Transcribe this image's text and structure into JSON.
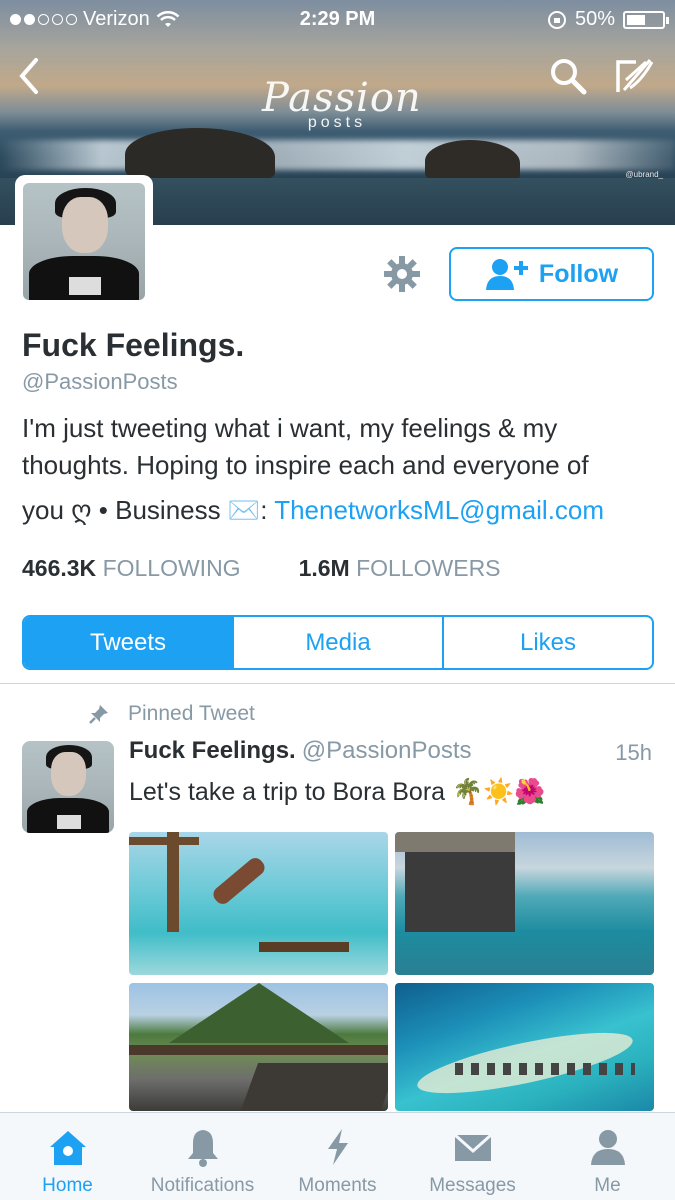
{
  "status_bar": {
    "carrier": "Verizon",
    "time": "2:29 PM",
    "battery": "50%",
    "signal_bars": 2
  },
  "banner": {
    "logo_line1": "Passion",
    "logo_line2": "posts",
    "credit": "@ubrand_"
  },
  "profile": {
    "name": "Fuck Feelings.",
    "handle": "@PassionPosts",
    "follow_label": "Follow",
    "bio_line1": "I'm just tweeting what i want, my feelings & my",
    "bio_line2": "thoughts. Hoping to inspire each and everyone of",
    "bio_line3_prefix": "you ღ • Business ✉️: ",
    "bio_email": "ThenetworksML@gmail.com",
    "following_count": "466.3K",
    "following_label": "FOLLOWING",
    "followers_count": "1.6M",
    "followers_label": "FOLLOWERS"
  },
  "tabs": [
    "Tweets",
    "Media",
    "Likes"
  ],
  "active_tab": "Tweets",
  "pinned_tweet": {
    "pinned_label": "Pinned Tweet",
    "name": "Fuck Feelings.",
    "handle": "@PassionPosts",
    "time": "15h",
    "text": "Let's take a trip to Bora Bora 🌴☀️🌺"
  },
  "bottom_nav": {
    "items": [
      "Home",
      "Notifications",
      "Moments",
      "Messages",
      "Me"
    ],
    "active": "Home"
  },
  "colors": {
    "accent": "#1da1f2",
    "muted": "#8899a6",
    "text": "#292f33"
  }
}
